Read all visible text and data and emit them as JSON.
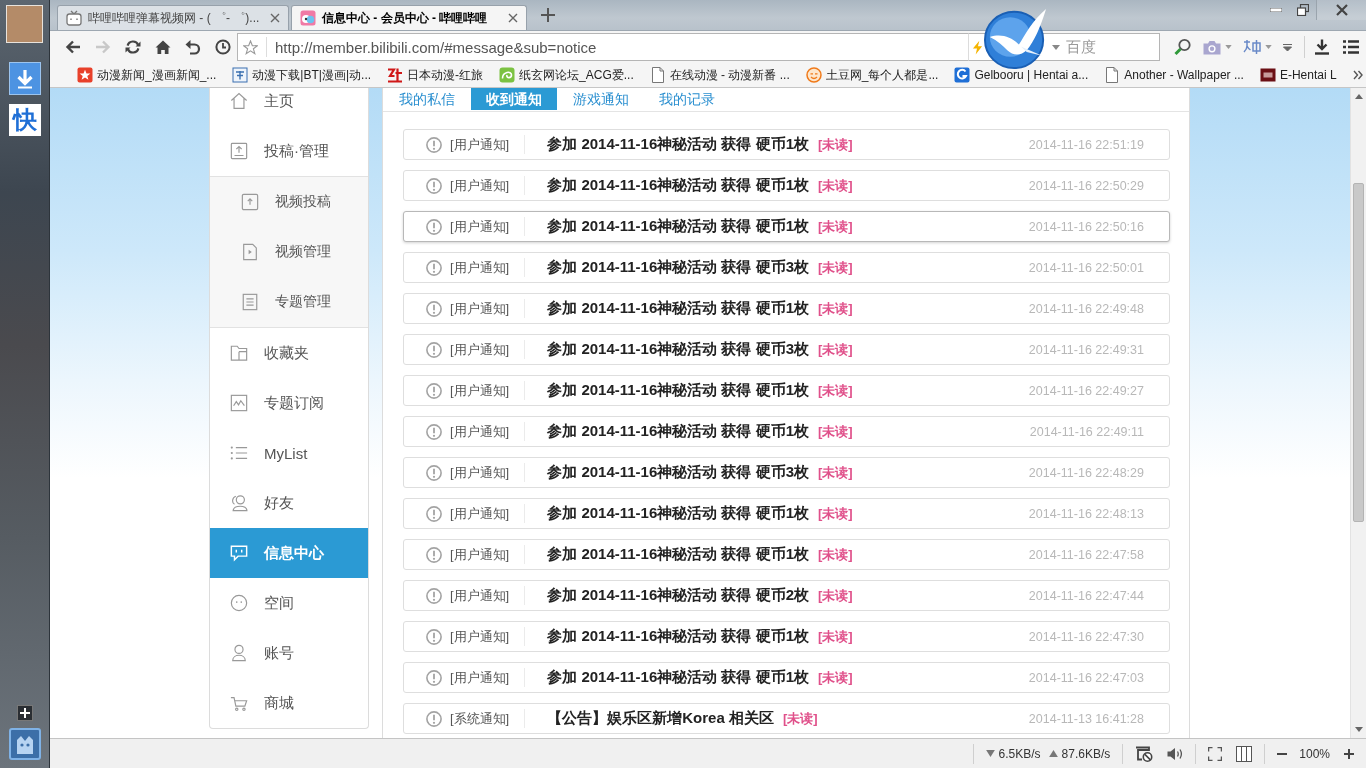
{
  "side_panel": {
    "quick_tile": "快"
  },
  "browser": {
    "tabs": [
      {
        "title": "哔哩哔哩弹幕视频网 - ( ゜- ゜)...",
        "kind": "tv",
        "selected": false
      },
      {
        "title": "信息中心 - 会员中心 - 哔哩哔哩",
        "kind": "logo",
        "selected": true
      }
    ],
    "nav": {
      "back_disabled": false,
      "forward_disabled": true
    },
    "address": {
      "url": "http://member.bilibili.com/#message&sub=notice"
    },
    "search": {
      "placeholder": "百度"
    },
    "bookmarks": [
      {
        "label": "动漫新闻_漫画新闻_...",
        "kind": "star"
      },
      {
        "label": "动漫下载|BT|漫画|动...",
        "kind": "tile"
      },
      {
        "label": "日本动漫-红旅",
        "kind": "mark"
      },
      {
        "label": "纸玄网论坛_ACG爱...",
        "kind": "swirl"
      },
      {
        "label": "在线动漫 - 动漫新番 ...",
        "kind": "page"
      },
      {
        "label": "土豆网_每个人都是...",
        "kind": "smiley"
      },
      {
        "label": "Gelbooru | Hentai a...",
        "kind": "arc"
      },
      {
        "label": "Another - Wallpaper ...",
        "kind": "page"
      },
      {
        "label": "E-Hentai L",
        "kind": "square"
      }
    ]
  },
  "sidebar": {
    "items": [
      {
        "label": "主页",
        "kind": "home",
        "selected": false
      },
      {
        "label": "投稿·管理",
        "kind": "upload",
        "selected": false,
        "children": [
          {
            "label": "视频投稿",
            "kind": "upload-box",
            "selected": false
          },
          {
            "label": "视频管理",
            "kind": "video",
            "selected": false
          },
          {
            "label": "专题管理",
            "kind": "doc",
            "selected": false
          }
        ]
      },
      {
        "label": "收藏夹",
        "kind": "folder",
        "selected": false
      },
      {
        "label": "专题订阅",
        "kind": "image",
        "selected": false
      },
      {
        "label": "MyList",
        "kind": "list",
        "selected": false
      },
      {
        "label": "好友",
        "kind": "friends",
        "selected": false
      },
      {
        "label": "信息中心",
        "kind": "chat",
        "selected": true
      },
      {
        "label": "空间",
        "kind": "face",
        "selected": false
      },
      {
        "label": "账号",
        "kind": "user",
        "selected": false
      },
      {
        "label": "商城",
        "kind": "cart",
        "selected": false
      }
    ]
  },
  "message_tabs": [
    {
      "label": "我的私信",
      "selected": false
    },
    {
      "label": "收到通知",
      "selected": true
    },
    {
      "label": "游戏通知",
      "selected": false
    },
    {
      "label": "我的记录",
      "selected": false
    }
  ],
  "notices": [
    {
      "category": "[用户通知]",
      "title": "参加 2014-11-16神秘活动 获得 硬币1枚",
      "badge": "[未读]",
      "time": "2014-11-16 22:51:19",
      "hovered": false
    },
    {
      "category": "[用户通知]",
      "title": "参加 2014-11-16神秘活动 获得 硬币1枚",
      "badge": "[未读]",
      "time": "2014-11-16 22:50:29",
      "hovered": false
    },
    {
      "category": "[用户通知]",
      "title": "参加 2014-11-16神秘活动 获得 硬币1枚",
      "badge": "[未读]",
      "time": "2014-11-16 22:50:16",
      "hovered": true
    },
    {
      "category": "[用户通知]",
      "title": "参加 2014-11-16神秘活动 获得 硬币3枚",
      "badge": "[未读]",
      "time": "2014-11-16 22:50:01",
      "hovered": false
    },
    {
      "category": "[用户通知]",
      "title": "参加 2014-11-16神秘活动 获得 硬币1枚",
      "badge": "[未读]",
      "time": "2014-11-16 22:49:48",
      "hovered": false
    },
    {
      "category": "[用户通知]",
      "title": "参加 2014-11-16神秘活动 获得 硬币3枚",
      "badge": "[未读]",
      "time": "2014-11-16 22:49:31",
      "hovered": false
    },
    {
      "category": "[用户通知]",
      "title": "参加 2014-11-16神秘活动 获得 硬币1枚",
      "badge": "[未读]",
      "time": "2014-11-16 22:49:27",
      "hovered": false
    },
    {
      "category": "[用户通知]",
      "title": "参加 2014-11-16神秘活动 获得 硬币1枚",
      "badge": "[未读]",
      "time": "2014-11-16 22:49:11",
      "hovered": false
    },
    {
      "category": "[用户通知]",
      "title": "参加 2014-11-16神秘活动 获得 硬币3枚",
      "badge": "[未读]",
      "time": "2014-11-16 22:48:29",
      "hovered": false
    },
    {
      "category": "[用户通知]",
      "title": "参加 2014-11-16神秘活动 获得 硬币1枚",
      "badge": "[未读]",
      "time": "2014-11-16 22:48:13",
      "hovered": false
    },
    {
      "category": "[用户通知]",
      "title": "参加 2014-11-16神秘活动 获得 硬币1枚",
      "badge": "[未读]",
      "time": "2014-11-16 22:47:58",
      "hovered": false
    },
    {
      "category": "[用户通知]",
      "title": "参加 2014-11-16神秘活动 获得 硬币2枚",
      "badge": "[未读]",
      "time": "2014-11-16 22:47:44",
      "hovered": false
    },
    {
      "category": "[用户通知]",
      "title": "参加 2014-11-16神秘活动 获得 硬币1枚",
      "badge": "[未读]",
      "time": "2014-11-16 22:47:30",
      "hovered": false
    },
    {
      "category": "[用户通知]",
      "title": "参加 2014-11-16神秘活动 获得 硬币1枚",
      "badge": "[未读]",
      "time": "2014-11-16 22:47:03",
      "hovered": false
    },
    {
      "category": "[系统通知]",
      "title": "【公告】娱乐区新增Korea 相关区",
      "badge": "[未读]",
      "time": "2014-11-13 16:41:28",
      "hovered": false
    }
  ],
  "status_bar": {
    "download_speed": "6.5KB/s",
    "upload_speed": "87.6KB/s",
    "zoom": "100%"
  }
}
